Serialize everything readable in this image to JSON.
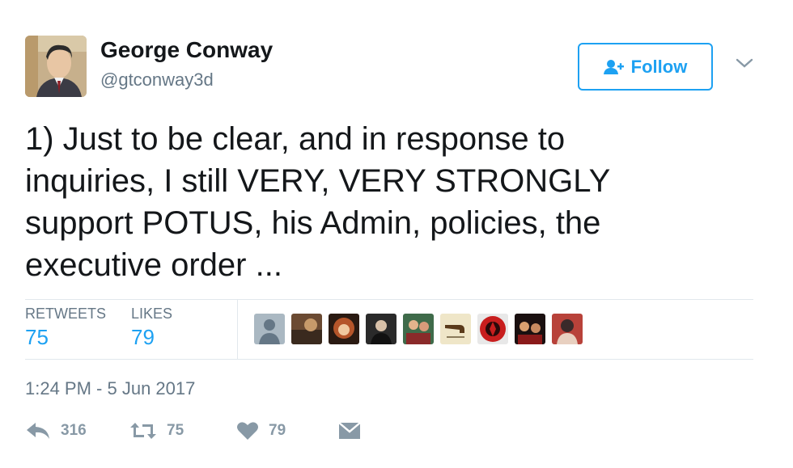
{
  "author": {
    "name": "George Conway",
    "handle": "@gtconway3d"
  },
  "follow_button": {
    "label": "Follow"
  },
  "tweet": {
    "text": "1) Just to be clear, and in response to\ninquiries, I still VERY, VERY STRONGLY\nsupport POTUS, his Admin, policies, the\nexecutive order ..."
  },
  "stats": {
    "retweets_label": "RETWEETS",
    "retweets_value": "75",
    "likes_label": "LIKES",
    "likes_value": "79"
  },
  "likers": [
    {
      "icon": "default-avatar",
      "color": "#aab8c2"
    },
    {
      "icon": "avatar-photo",
      "color": "#6b4a32"
    },
    {
      "icon": "avatar-photo",
      "color": "#b5552a"
    },
    {
      "icon": "avatar-photo",
      "color": "#2a2a2a"
    },
    {
      "icon": "avatar-photo",
      "color": "#3f6b4a"
    },
    {
      "icon": "avatar-pipe",
      "color": "#efe6c8"
    },
    {
      "icon": "avatar-logo",
      "color": "#c81e1e"
    },
    {
      "icon": "avatar-photo",
      "color": "#8a1a1a"
    },
    {
      "icon": "avatar-photo",
      "color": "#b8423a"
    }
  ],
  "timestamp": "1:24 PM - 5 Jun 2017",
  "actions": {
    "reply_count": "316",
    "retweet_count": "75",
    "like_count": "79"
  },
  "colors": {
    "accent": "#1da1f2",
    "muted": "#657786",
    "action_gray": "#8899a6",
    "divider": "#e1e8ed"
  }
}
